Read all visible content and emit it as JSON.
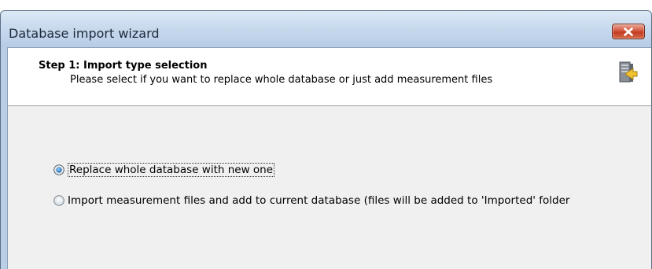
{
  "window": {
    "title": "Database import wizard",
    "close_icon": "close-icon"
  },
  "header": {
    "step_title": "Step 1: Import type selection",
    "step_description": "Please select if you want to replace whole database or just add measurement files",
    "icon": "database-import-icon"
  },
  "options": [
    {
      "label": "Replace whole database with new one",
      "selected": true,
      "focused": true
    },
    {
      "label": "Import measurement files and add to current database (files will be added to 'Imported' folder",
      "selected": false,
      "focused": false
    }
  ],
  "colors": {
    "title_bar": "#c4d7ec",
    "close_button": "#c33b22",
    "header_background": "#ffffff",
    "body_background": "#f0f0f0",
    "radio_selected": "#1f6fc5"
  }
}
